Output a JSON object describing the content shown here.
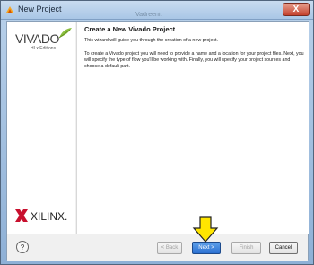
{
  "window": {
    "title": "New Project",
    "bg_tabs": [
      "",
      "Vadreenit"
    ],
    "close_label": "X"
  },
  "side": {
    "brand": "VIVADO",
    "edition": "HLx Editions",
    "vendor": "XILINX."
  },
  "content": {
    "heading": "Create a New Vivado Project",
    "intro": "This wizard will guide you through the creation of a new project.",
    "details": "To create a Vivado project you will need to provide a name and a location for your project files. Next, you will specify the type of flow you'll be working with. Finally, you will specify your project sources and choose a default part."
  },
  "footer": {
    "help": "?",
    "back": "< Back",
    "next": "Next >",
    "finish": "Finish",
    "cancel": "Cancel"
  },
  "colors": {
    "next_button": "#2a6fd0",
    "arrow": "#ffe500",
    "xilinx_mark": "#c8102e"
  }
}
